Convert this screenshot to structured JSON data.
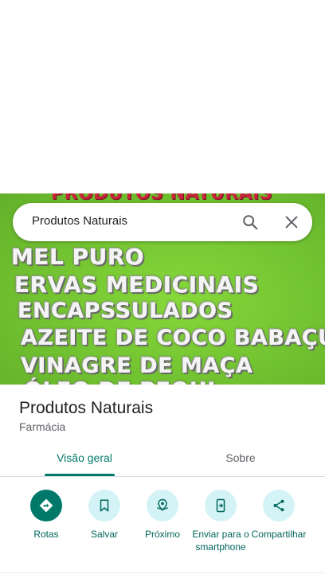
{
  "search": {
    "value": "Produtos Naturais"
  },
  "hero": {
    "lines": [
      "PRODUTOS NATURAIS",
      "MEL PURO",
      "ERVAS MEDICINAIS",
      "ENCAPSSULADOS",
      "AZEITE DE COCO BABAÇU",
      "VINAGRE DE MAÇA",
      "ÓLEO DE PEQUI"
    ]
  },
  "place": {
    "name": "Produtos Naturais",
    "category": "Farmácia"
  },
  "tabs": [
    {
      "label": "Visão geral",
      "active": true
    },
    {
      "label": "Sobre",
      "active": false
    }
  ],
  "actions": [
    {
      "label": "Rotas",
      "icon": "directions-icon"
    },
    {
      "label": "Salvar",
      "icon": "bookmark-icon"
    },
    {
      "label": "Próximo",
      "icon": "nearby-icon"
    },
    {
      "label": "Enviar para o smartphone",
      "icon": "send-to-phone-icon"
    },
    {
      "label": "Compartilhar",
      "icon": "share-icon"
    }
  ],
  "colors": {
    "accent": "#00796b",
    "action_bg": "#d3f3f6",
    "hero_bg": "#72c331"
  }
}
